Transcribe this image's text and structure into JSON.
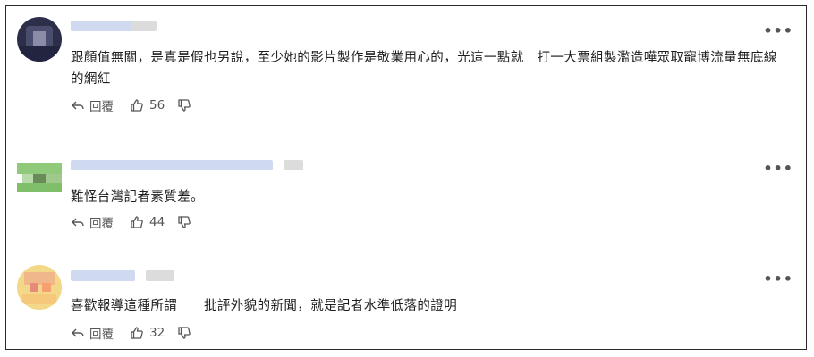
{
  "comments": [
    {
      "text": "跟顏值無關，是真是假也另說，至少她的影片製作是敬業用心的，光這一點就　打一大票組製濫造嘩眾取寵博流量無底線的網紅",
      "reply_label": "回覆",
      "like_count": "56",
      "more_label": "•••"
    },
    {
      "text": "難怪台灣記者素質差。",
      "reply_label": "回覆",
      "like_count": "44",
      "more_label": "•••"
    },
    {
      "text": "喜歡報導這種所謂　　批評外貌的新聞，就是記者水準低落的證明",
      "reply_label": "回覆",
      "like_count": "32",
      "more_label": "•••"
    }
  ],
  "colors": {
    "name_blur": "#cfd9f0",
    "text": "#1e1e1e",
    "icon": "#555555",
    "border": "#2a2a2a"
  },
  "icons": {
    "reply": "reply-arrow-icon",
    "like": "thumbs-up-icon",
    "dislike": "thumbs-down-icon",
    "more": "more-horizontal-icon"
  }
}
